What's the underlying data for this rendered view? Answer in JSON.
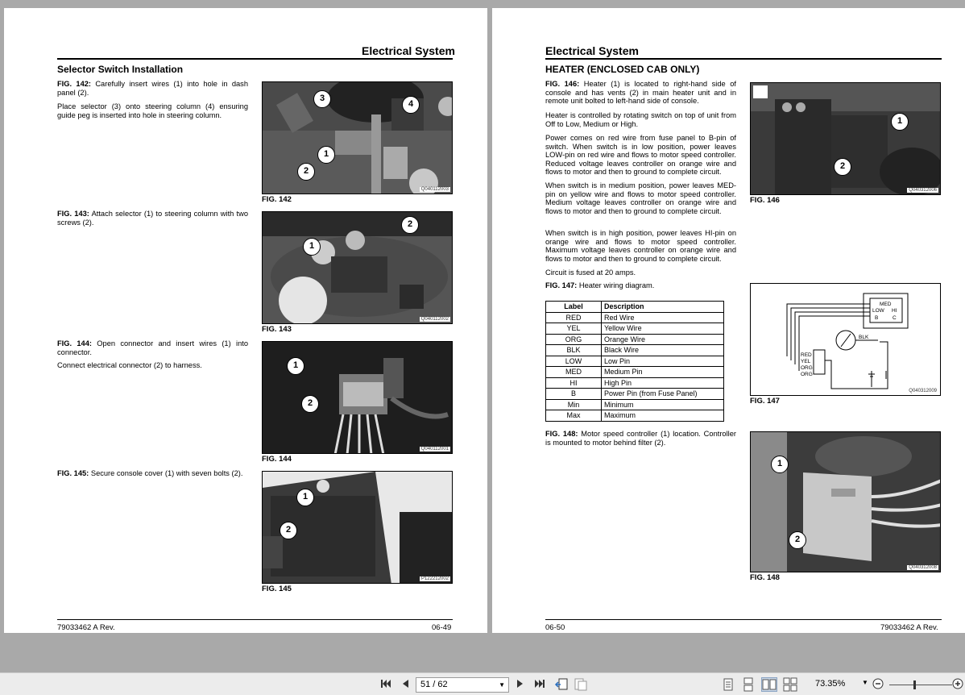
{
  "left_page": {
    "header": "Electrical System",
    "section_title": "Selector Switch Installation",
    "paragraphs": [
      {
        "fig": "FIG. 142:",
        "text": " Carefully insert wires (1) into hole in dash panel (2)."
      },
      {
        "fig": "",
        "text": "Place selector (3) onto steering column (4) ensuring guide peg is inserted into hole in steering column."
      },
      {
        "fig": "FIG. 143:",
        "text": " Attach selector (1) to steering column with two screws (2)."
      },
      {
        "fig": "FIG. 144:",
        "text": " Open connector and insert wires (1) into connector."
      },
      {
        "fig": "",
        "text": "Connect electrical connector (2) to harness."
      },
      {
        "fig": "FIG. 145:",
        "text": " Secure console cover (1) with seven bolts (2)."
      }
    ],
    "figures": [
      {
        "label": "FIG. 142",
        "code": "Q040112003",
        "callouts": [
          "3",
          "4",
          "1",
          "2"
        ]
      },
      {
        "label": "FIG. 143",
        "code": "Q040112002",
        "callouts": [
          "2",
          "1"
        ]
      },
      {
        "label": "FIG. 144",
        "code": "Q040112001",
        "callouts": [
          "1",
          "2"
        ]
      },
      {
        "label": "FIG. 145",
        "code": "P122212002",
        "callouts": [
          "1",
          "2"
        ]
      }
    ],
    "footer_left": "79033462 A Rev.",
    "footer_right": "06-49"
  },
  "right_page": {
    "header": "Electrical System",
    "section_title": "HEATER (ENCLOSED CAB ONLY)",
    "paragraphs": [
      {
        "fig": "FIG. 146:",
        "text": " Heater (1) is located to right-hand side of console and has vents (2) in main heater unit and in remote unit bolted to left-hand side of console."
      },
      {
        "fig": "",
        "text": "Heater is controlled by rotating switch on top of unit from Off to Low, Medium or High."
      },
      {
        "fig": "",
        "text": "Power comes on red wire from fuse panel to B-pin of switch. When switch is in low position, power leaves LOW-pin on red wire and flows to motor speed controller. Reduced voltage leaves controller on orange wire and flows to motor and then to ground to complete circuit."
      },
      {
        "fig": "",
        "text": "When switch is in medium position, power leaves MED-pin on yellow wire and flows to motor speed controller. Medium voltage leaves controller on orange wire and flows to motor and then to ground to complete circuit."
      },
      {
        "fig": "",
        "text": "When switch is in high position, power leaves HI-pin on orange wire and flows to motor speed controller. Maximum voltage leaves controller on orange wire and flows to motor and then to ground to complete circuit."
      },
      {
        "fig": "",
        "text": "Circuit is fused at 20 amps."
      },
      {
        "fig": "FIG. 147:",
        "text": " Heater wiring diagram."
      },
      {
        "fig": "FIG. 148:",
        "text": " Motor speed controller (1) location. Controller is mounted to motor behind filter (2)."
      }
    ],
    "table": {
      "headers": [
        "Label",
        "Description"
      ],
      "rows": [
        [
          "RED",
          "Red Wire"
        ],
        [
          "YEL",
          "Yellow Wire"
        ],
        [
          "ORG",
          "Orange Wire"
        ],
        [
          "BLK",
          "Black Wire"
        ],
        [
          "LOW",
          "Low Pin"
        ],
        [
          "MED",
          "Medium Pin"
        ],
        [
          "HI",
          "High Pin"
        ],
        [
          "B",
          "Power Pin (from Fuse Panel)"
        ],
        [
          "Min",
          "Minimum"
        ],
        [
          "Max",
          "Maximum"
        ]
      ]
    },
    "figures": [
      {
        "label": "FIG. 146",
        "code": "Q040312006",
        "callouts": [
          "1",
          "2"
        ]
      },
      {
        "label": "FIG. 147",
        "code": "Q040312009",
        "diagram_labels": [
          "MED",
          "LOW",
          "HI",
          "B",
          "C",
          "BLK",
          "RED",
          "YEL",
          "ORG",
          "ORG"
        ]
      },
      {
        "label": "FIG. 148",
        "code": "Q040312008",
        "callouts": [
          "1",
          "2"
        ]
      }
    ],
    "footer_left": "06-50",
    "footer_right": "79033462 A Rev."
  },
  "toolbar": {
    "page_indicator": "51 / 62",
    "zoom": "73.35%",
    "icons": [
      "first-page-icon",
      "previous-page-icon",
      "next-page-icon",
      "last-page-icon",
      "previous-view-icon",
      "next-view-icon",
      "single-page-icon",
      "continuous-page-icon",
      "facing-pages-icon",
      "continuous-facing-icon",
      "zoom-out-icon",
      "zoom-in-icon"
    ]
  }
}
